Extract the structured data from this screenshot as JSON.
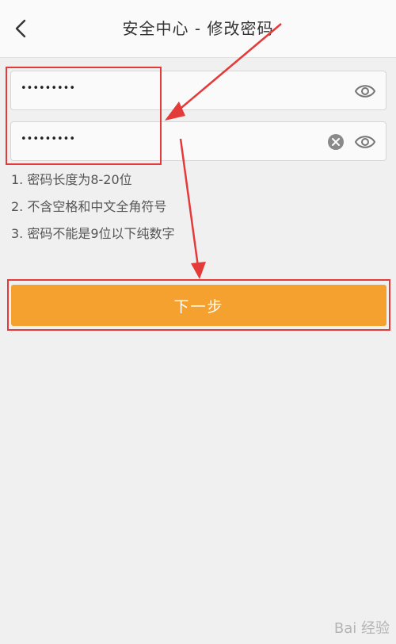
{
  "header": {
    "title": "安全中心 - 修改密码"
  },
  "form": {
    "password1_value": "•••••••••",
    "password2_value": "•••••••••"
  },
  "rules": [
    "1. 密码长度为8-20位",
    "2. 不含空格和中文全角符号",
    "3. 密码不能是9位以下纯数字"
  ],
  "next_button": {
    "label": "下一步"
  },
  "icons": {
    "back": "chevron-left-icon",
    "eye": "eye-icon",
    "clear": "clear-circle-icon"
  },
  "colors": {
    "accent": "#f4a12f",
    "annotation": "#e53a3a"
  },
  "watermark": "Bai 经验"
}
